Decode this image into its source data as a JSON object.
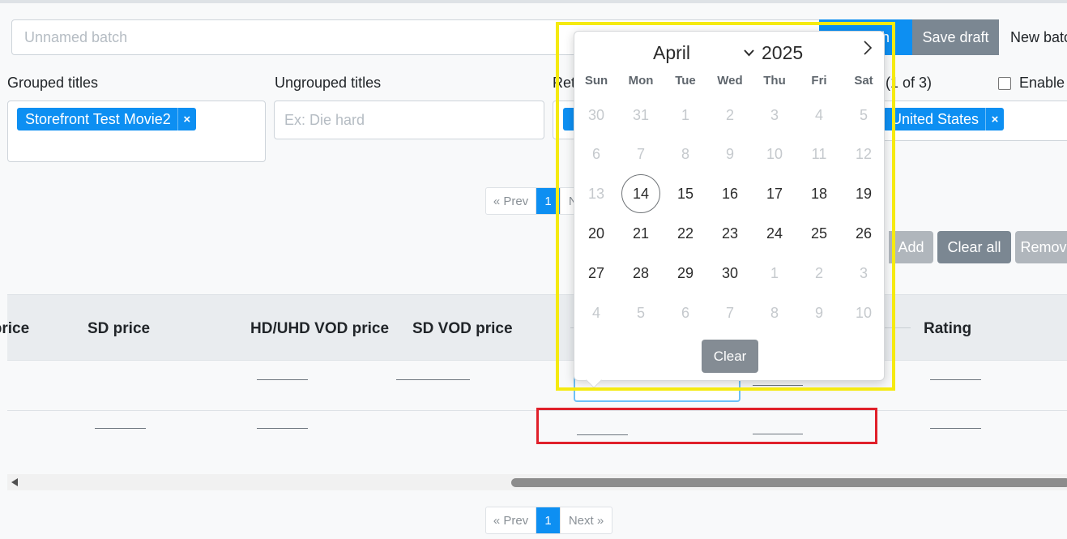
{
  "batch": {
    "name_placeholder": "Unnamed batch"
  },
  "toolbar": {
    "publish_label": "Publish",
    "save_label": "Save draft",
    "new_batch_label": "New batch"
  },
  "filters": {
    "grouped_label": "Grouped titles",
    "grouped_tags": [
      "Storefront Test Movie2"
    ],
    "ungrouped_label": "Ungrouped titles",
    "ungrouped_placeholder": "Ex: Die hard",
    "retailers_label": "Retailers",
    "countries_count": "(1 of 3)",
    "country_tag": "United States",
    "enable_label": "Enable rules",
    "tag_remove_glyph": "×"
  },
  "pagination": {
    "prev": "« Prev",
    "current": "1",
    "next": "Next »"
  },
  "actions": {
    "add": "Add",
    "clear_all": "Clear all",
    "remove": "Remove"
  },
  "table": {
    "headers": [
      "HD price",
      "SD price",
      "HD/UHD VOD price",
      "SD VOD price",
      "Rating"
    ]
  },
  "calendar": {
    "month": "April",
    "year": "2025",
    "next_glyph": "›",
    "weekdays": [
      "Sun",
      "Mon",
      "Tue",
      "Wed",
      "Thu",
      "Fri",
      "Sat"
    ],
    "weeks": [
      [
        "30",
        "31",
        "1",
        "2",
        "3",
        "4",
        "5"
      ],
      [
        "6",
        "7",
        "8",
        "9",
        "10",
        "11",
        "12"
      ],
      [
        "13",
        "14",
        "15",
        "16",
        "17",
        "18",
        "19"
      ],
      [
        "20",
        "21",
        "22",
        "23",
        "24",
        "25",
        "26"
      ],
      [
        "27",
        "28",
        "29",
        "30",
        "1",
        "2",
        "3"
      ],
      [
        "4",
        "5",
        "6",
        "7",
        "8",
        "9",
        "10"
      ]
    ],
    "disabled_until": "14",
    "selected_day": "14",
    "clear_label": "Clear"
  },
  "colors": {
    "primary": "#0d8ff2",
    "highlight_yellow": "#f5ea10",
    "highlight_red": "#e0202a"
  }
}
